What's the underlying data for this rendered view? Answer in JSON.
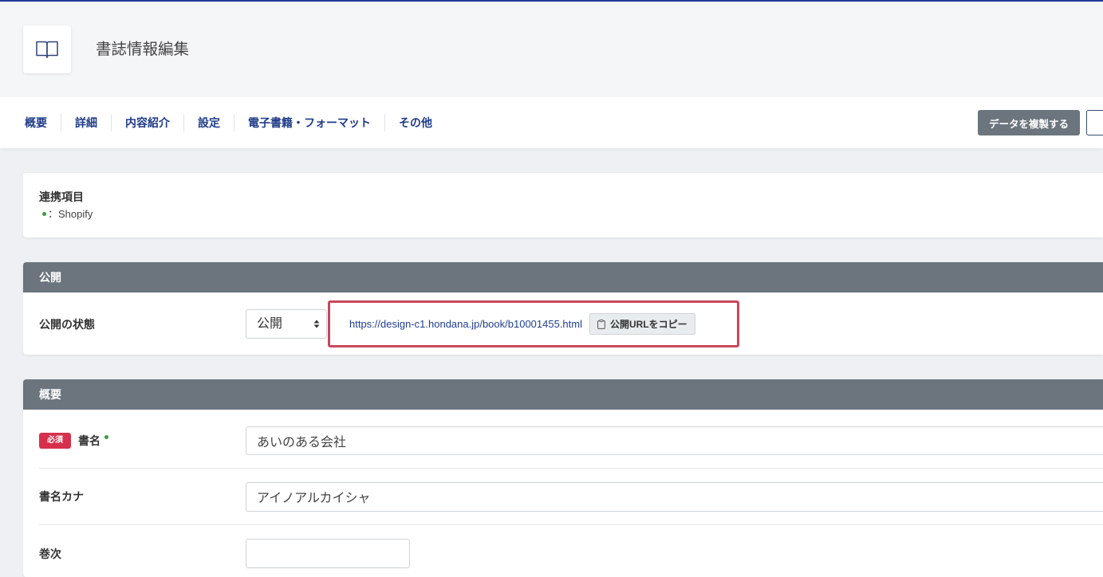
{
  "page": {
    "title": "書誌情報編集",
    "icon": "book-icon"
  },
  "tabs": [
    {
      "label": "概要"
    },
    {
      "label": "詳細"
    },
    {
      "label": "内容紹介"
    },
    {
      "label": "設定"
    },
    {
      "label": "電子書籍・フォーマット"
    },
    {
      "label": "その他"
    }
  ],
  "actions": {
    "duplicate_label": "データを複製する"
  },
  "integration": {
    "title": "連携項目",
    "legend_text": "：Shopify"
  },
  "publish_section": {
    "title": "公開",
    "status_label": "公開の状態",
    "status_value": "公開",
    "public_url": "https://design-c1.hondana.jp/book/b10001455.html",
    "copy_button_label": "公開URLをコピー",
    "copy_icon": "clipboard-icon"
  },
  "overview_section": {
    "title": "概要",
    "fields": [
      {
        "required_badge": "必須",
        "label": "書名",
        "value": "あいのある会社",
        "synced": true
      },
      {
        "label": "書名カナ",
        "value": "アイノアルカイシャ"
      },
      {
        "label": "巻次",
        "value": ""
      }
    ]
  },
  "colors": {
    "top_accent": "#1d3a9c",
    "tab_text": "#1f3c88",
    "link": "#1f3f92",
    "section_header": "#6c757d",
    "duplicate_button": "#6c757d",
    "required_badge": "#d7304c",
    "sync_dot": "#3a9a48",
    "highlight_border": "#c9485b"
  }
}
